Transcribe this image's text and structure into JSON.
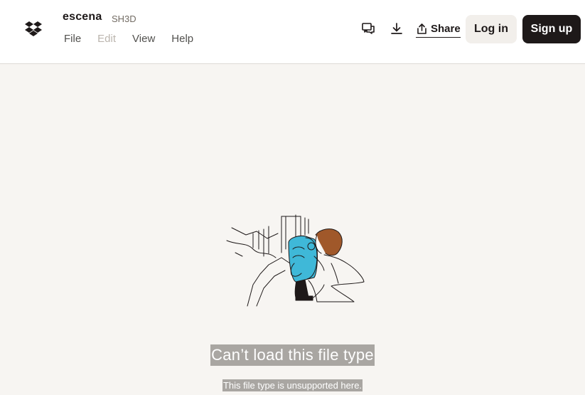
{
  "header": {
    "file_name": "escena",
    "file_ext": "SH3D",
    "menu": [
      {
        "label": "File",
        "enabled": true
      },
      {
        "label": "Edit",
        "enabled": false
      },
      {
        "label": "View",
        "enabled": true
      },
      {
        "label": "Help",
        "enabled": true
      }
    ],
    "icons": {
      "comments": "comments-icon",
      "download": "download-icon",
      "share": "share-icon",
      "logo": "dropbox-logo-icon"
    },
    "share_label": "Share",
    "login_label": "Log in",
    "signup_label": "Sign up"
  },
  "main": {
    "error_title": "Can’t load this file type",
    "error_subtitle": "This file type is unsupported here."
  },
  "colors": {
    "accent_illustration": "#3fb8d8",
    "dark": "#1e1919",
    "background": "#f7f5f2"
  }
}
